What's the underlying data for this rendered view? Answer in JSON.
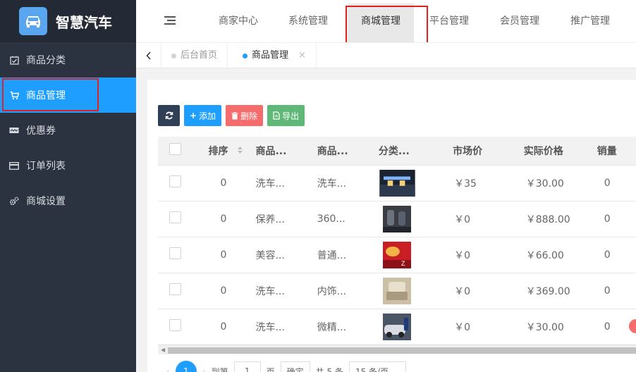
{
  "app": {
    "name": "智慧汽车"
  },
  "sidebar": {
    "items": [
      {
        "label": "商品分类",
        "icon": "calendar-check-icon"
      },
      {
        "label": "商品管理",
        "icon": "cart-icon",
        "active": true
      },
      {
        "label": "优惠券",
        "icon": "coupon-icon"
      },
      {
        "label": "订单列表",
        "icon": "card-icon"
      },
      {
        "label": "商城设置",
        "icon": "gears-icon"
      }
    ]
  },
  "topnav": {
    "items": [
      {
        "label": "商家中心"
      },
      {
        "label": "系统管理"
      },
      {
        "label": "商城管理",
        "active": true
      },
      {
        "label": "平台管理"
      },
      {
        "label": "会员管理"
      },
      {
        "label": "推广管理"
      }
    ]
  },
  "tabs": [
    {
      "label": "后台首页"
    },
    {
      "label": "商品管理",
      "active": true,
      "close": "×"
    }
  ],
  "toolbar": {
    "add": "添加",
    "delete": "删除",
    "export": "导出"
  },
  "table": {
    "headers": [
      "排序",
      "商品...",
      "商品...",
      "分类...",
      "市场价",
      "实际价格",
      "销量"
    ],
    "rows": [
      {
        "sort": "0",
        "name1": "洗车...",
        "name2": "洗车...",
        "market": "￥35",
        "price": "￥30.00",
        "sales": "0",
        "img": "night-storefront"
      },
      {
        "sort": "0",
        "name1": "保养...",
        "name2": "360...",
        "market": "￥0",
        "price": "￥888.00",
        "sales": "0",
        "img": "car-seats"
      },
      {
        "sort": "0",
        "name1": "美容...",
        "name2": "普通...",
        "market": "￥0",
        "price": "￥66.00",
        "sales": "0",
        "img": "red-car-polish"
      },
      {
        "sort": "0",
        "name1": "洗车...",
        "name2": "内饰...",
        "market": "￥0",
        "price": "￥369.00",
        "sales": "0",
        "img": "car-interior"
      },
      {
        "sort": "0",
        "name1": "洗车...",
        "name2": "微精...",
        "market": "￥0",
        "price": "￥30.00",
        "sales": "0",
        "img": "car-wash-worker"
      }
    ]
  },
  "pager": {
    "current": "1",
    "goto_label": "到第",
    "page_input": "1",
    "page_unit": "页",
    "confirm": "确定",
    "total": "共 5 条",
    "per_page": "15 条/页"
  }
}
